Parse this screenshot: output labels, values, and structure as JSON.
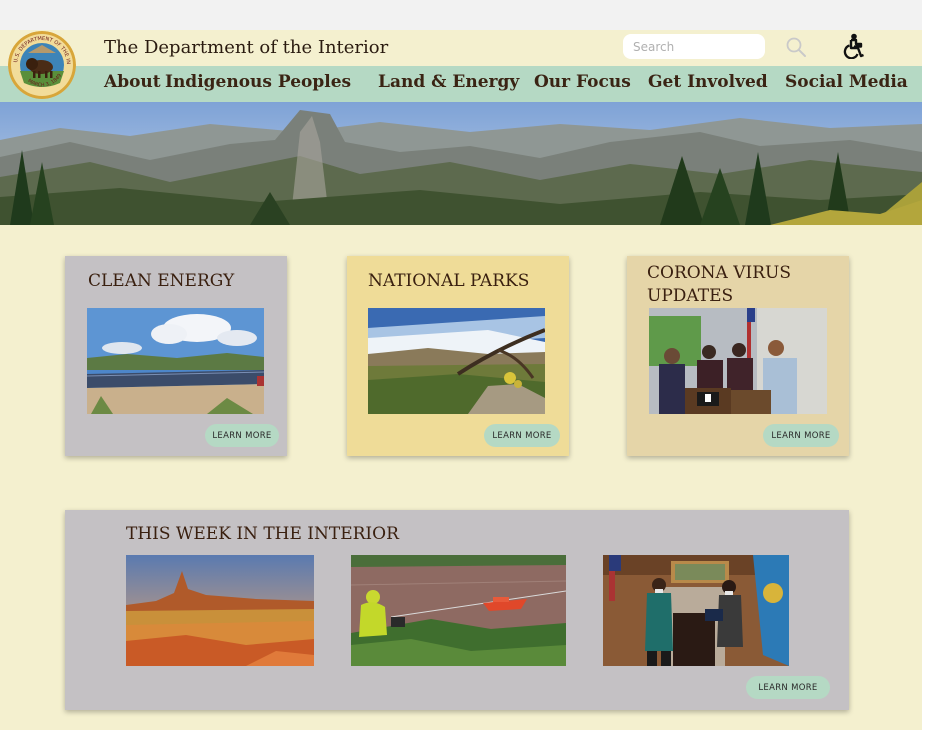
{
  "header": {
    "site_title": "The Department of the Interior",
    "seal_icon": "department-seal-logo",
    "seal_text": "U.S. DEPARTMENT OF THE INTERIOR MARCH 3, 1849",
    "search": {
      "placeholder": "Search"
    },
    "search_icon": "search-icon",
    "accessibility_icon": "accessibility-icon"
  },
  "nav": {
    "items": [
      {
        "label": "About"
      },
      {
        "label": "Indigenous Peoples"
      },
      {
        "label": "Land & Energy"
      },
      {
        "label": "Our Focus"
      },
      {
        "label": "Get Involved"
      },
      {
        "label": "Social Media"
      }
    ]
  },
  "cards": [
    {
      "title": "CLEAN ENERGY",
      "button": "LEARN  MORE"
    },
    {
      "title_line1": "NATIONAL PARKS",
      "button": "LEARN  MORE"
    },
    {
      "title_line1": "CORONA VIRUS",
      "title_line2": "UPDATES",
      "button": "LEARN  MORE"
    }
  ],
  "week": {
    "title": "THIS WEEK IN THE INTERIOR",
    "button": "LEARN  MORE"
  },
  "colors": {
    "page_bg": "#f4f0cf",
    "nav_bg": "#b5d9c4",
    "card_gray": "#c4c1c4",
    "card_yellow": "#efdc98",
    "card_tan": "#e5d5a8",
    "button_green": "#b5d9c4"
  }
}
